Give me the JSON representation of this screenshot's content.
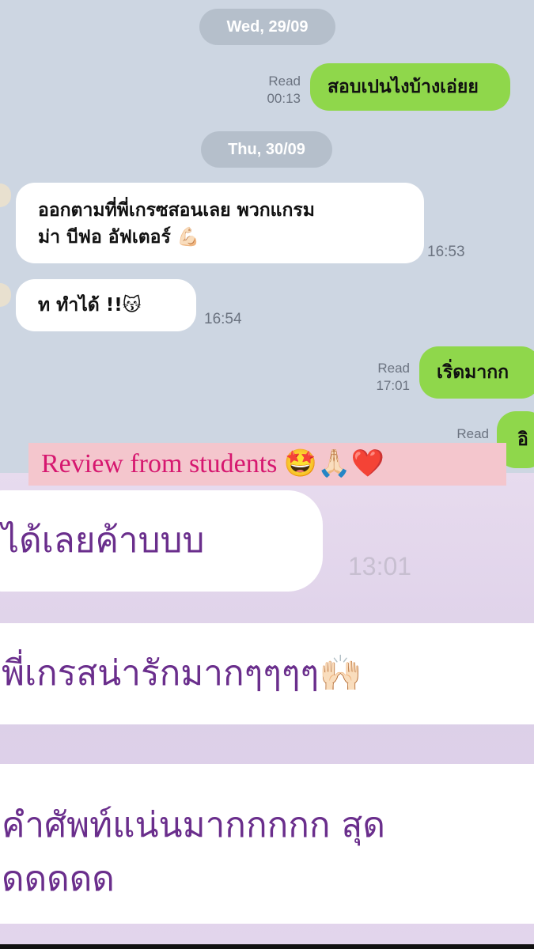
{
  "chat1": {
    "date1": "Wed, 29/09",
    "msg1": {
      "status": "Read",
      "time": "00:13",
      "text": "สอบเปนไงบ้างเอ่ยย"
    },
    "date2": "Thu, 30/09",
    "msg2": {
      "line1": "ออกตามที่พี่เกรซสอนเลย พวกแกรม",
      "line2": "ม่า บีฟอ อัฟเตอร์ 💪🏻",
      "time": "16:53"
    },
    "msg3": {
      "text": "ท ทำได้ !!😽",
      "time": "16:54"
    },
    "msg4": {
      "status": "Read",
      "time": "17:01",
      "text": "เริ่ดมากก"
    },
    "msg5": {
      "status": "Read",
      "text": "อิ"
    }
  },
  "caption": {
    "text": "Review from students 🤩🙏🏻❤️"
  },
  "chat2": {
    "msg1": {
      "text": "ได้เลยค้าบบบ",
      "time": "13:01"
    },
    "msg2": {
      "text": "พี่เกรสน่ารักมากๆๆๆๆ🙌🏻"
    },
    "msg3": {
      "line1": "คำศัพท์แน่นมากกกกก สุด",
      "line2": "ดดดดด"
    }
  },
  "colors": {
    "chat_bg": "#cdd6e2",
    "sent_bubble": "#8fd74b",
    "received_bubble": "#ffffff",
    "caption_bg": "#f4c6cd",
    "caption_text": "#d6176f",
    "purple_text": "#6a2e8c"
  }
}
